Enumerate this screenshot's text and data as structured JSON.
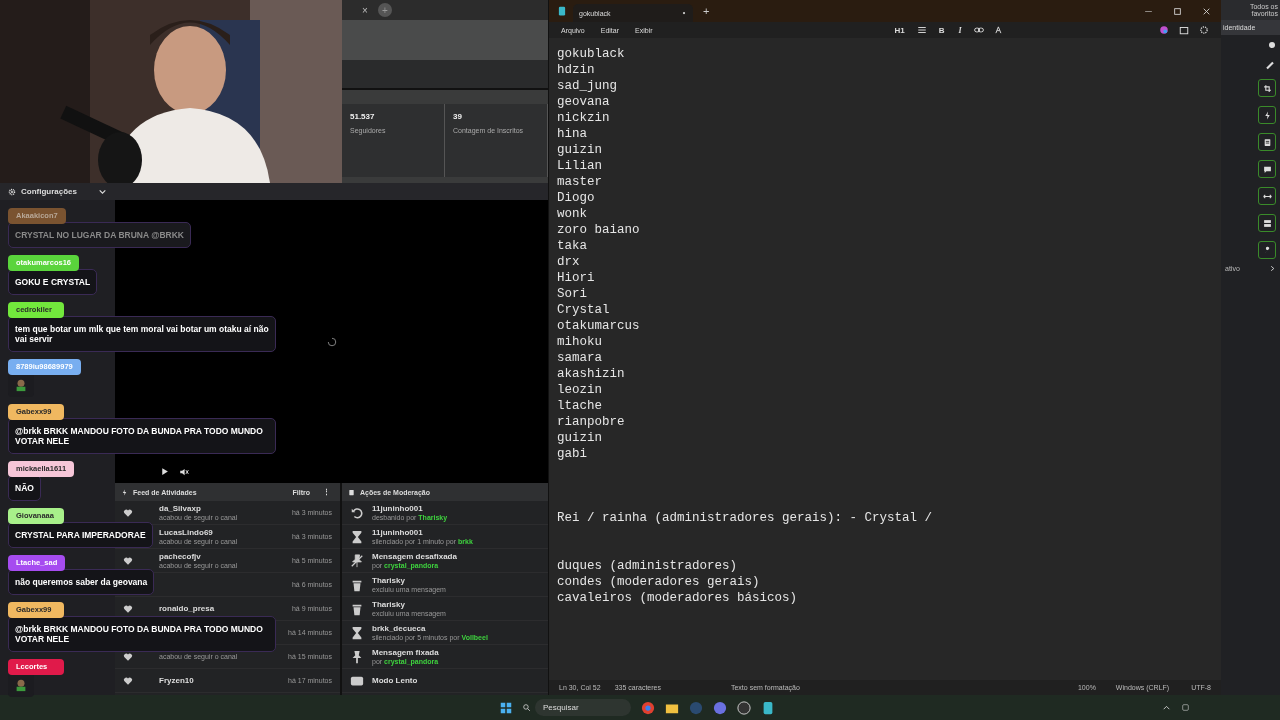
{
  "dashboard_tabs": {
    "close": "×",
    "add": "+"
  },
  "stats": [
    {
      "value": "51.537",
      "label": "Seguidores"
    },
    {
      "value": "39",
      "label": "Contagem de Inscritos"
    }
  ],
  "chat_header": {
    "title": "Configurações"
  },
  "chat": [
    {
      "user": "Akaakicon7",
      "color": "#7a5330",
      "kind": "text",
      "text": "CRYSTAL NO LUGAR DA BRUNA @BRKK",
      "faded": true
    },
    {
      "user": "otakumarcos16",
      "color": "#5ad43c",
      "kind": "text",
      "text": "GOKU E CRYSTAL",
      "faded": false
    },
    {
      "user": "cedrokiler",
      "color": "#72e83c",
      "kind": "text",
      "text": "tem que botar um mlk que tem moral vai botar um otaku aí não vai servir",
      "faded": false
    },
    {
      "user": "8789iu98689979",
      "color": "#78aef0",
      "kind": "emote",
      "faded": false
    },
    {
      "user": "Gabexx99",
      "color": "#f0b860",
      "kind": "text",
      "text": "@brkk BRKK MANDOU FOTO DA BUNDA PRA TODO MUNDO VOTAR NELE",
      "faded": false
    },
    {
      "user": "mickaella1611",
      "color": "#f6c6d8",
      "kind": "text",
      "text": "NÃO",
      "faded": false
    },
    {
      "user": "Giovanaaa",
      "color": "#a8f08a",
      "kind": "text",
      "text": "CRYSTAL PARA IMPERADORAE",
      "faded": false
    },
    {
      "user": "Ltache_sad",
      "color": "#a64cf0",
      "kind": "text",
      "text": "não queremos saber da geovana",
      "faded": false
    },
    {
      "user": "Gabexx99",
      "color": "#f0b860",
      "kind": "text",
      "text": "@brkk BRKK MANDOU FOTO DA BUNDA PRA TODO MUNDO VOTAR NELE",
      "faded": false
    },
    {
      "user": "Lccortes",
      "color": "#e01a4a",
      "kind": "emote",
      "faded": false
    }
  ],
  "feed": {
    "title": "Feed de Atividades",
    "filter": "Filtro",
    "menu": "⋮",
    "rows": [
      {
        "kind": "follow",
        "name": "da_Silvaxp",
        "detail": "acabou de seguir o canal",
        "time": "há 3 minutos"
      },
      {
        "kind": "covered",
        "name": "LucasLindo69",
        "detail": "acabou de seguir o canal",
        "time": "há 3 minutos"
      },
      {
        "kind": "follow",
        "name": "pachecofjv",
        "detail": "acabou de seguir o canal",
        "time": "há 5 minutos"
      },
      {
        "kind": "covered",
        "time": "há 6 minutos"
      },
      {
        "kind": "follow",
        "name": "ronaldo_presa",
        "time": "há 9 minutos"
      },
      {
        "kind": "covered",
        "time": "há 14 minutos"
      },
      {
        "kind": "follow",
        "detail": "acabou de seguir o canal",
        "time": "há 15 minutos"
      },
      {
        "kind": "follow",
        "name": "Fryzen10",
        "time": "há 17 minutos"
      }
    ]
  },
  "moderation": {
    "title": "Ações de Moderação",
    "rows": [
      {
        "kind": "unban",
        "title": "11juninho001",
        "detail": "desbanido por",
        "actor": "Tharisky"
      },
      {
        "kind": "timeout",
        "title": "11juninho001",
        "detail": "silenciado por 1 minuto por",
        "actor": "brkk"
      },
      {
        "kind": "unpin",
        "title": "Mensagem desafixada",
        "detail": "por",
        "actor": "crystal_pandora"
      },
      {
        "kind": "delete",
        "title": "Tharisky",
        "detail": "excluiu uma mensagem"
      },
      {
        "kind": "delete",
        "title": "Tharisky",
        "detail": "excluiu uma mensagem"
      },
      {
        "kind": "timeout",
        "title": "brkk_decueca",
        "detail": "silenciado por 5 minutos por",
        "actor": "Vollbeel"
      },
      {
        "kind": "pin",
        "title": "Mensagem fixada",
        "detail": "por",
        "actor": "crystal_pandora"
      },
      {
        "kind": "slow",
        "title": "Modo Lento"
      }
    ]
  },
  "notepad": {
    "tab": "gokublack",
    "add_tab": "+",
    "menu": [
      "Arquivo",
      "Editar",
      "Exibir"
    ],
    "toolbar": {
      "heading": "H1",
      "bold": "B",
      "italic": "I"
    },
    "names": [
      "gokublack",
      "hdzin",
      "sad_jung",
      "geovana",
      "nickzin",
      "hina",
      "guizin",
      "Lilian",
      "master",
      "Diogo",
      "wonk",
      "zoro baiano",
      "taka",
      "drx",
      "Hiori",
      "Sori",
      "Crystal",
      "otakumarcus",
      "mihoku",
      "samara",
      "akashizin",
      "leozin",
      "ltache",
      "rianpobre",
      "guizin",
      "gabi"
    ],
    "heading_line": "Rei / rainha (administradores gerais): - Crystal /",
    "roles": [
      "duques (administradores)",
      "condes (moderadores gerais)",
      "cavaleiros (moderadores básicos)"
    ],
    "status": {
      "position": "Ln 30, Col 52",
      "count": "335 caracteres",
      "format": "Texto sem formatação",
      "zoom": "100%",
      "eol": "Windows (CRLF)",
      "encoding": "UTF-8"
    }
  },
  "browser": {
    "favorites": "Todos os favoritos",
    "identity": "identidade",
    "row_label": "ativo"
  },
  "taskbar": {
    "placeholder": "Pesquisar"
  }
}
